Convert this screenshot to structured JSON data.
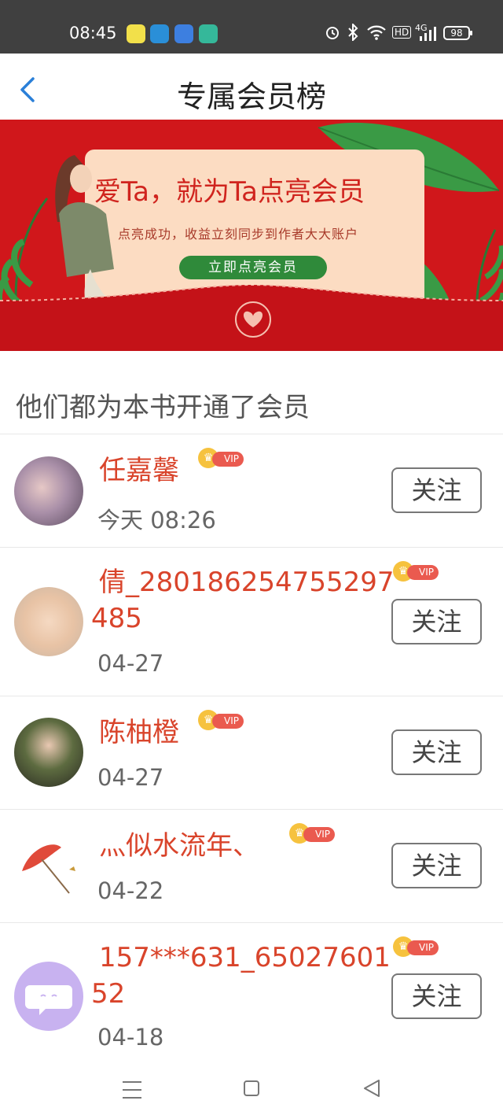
{
  "status_bar": {
    "time": "08:45",
    "hd": "HD",
    "network": "4G",
    "battery": "98"
  },
  "header": {
    "title": "专属会员榜"
  },
  "banner": {
    "headline": "爱Ta，就为Ta点亮会员",
    "subtitle": "点亮成功，收益立刻同步到作者大大账户",
    "button_label": "立即点亮会员"
  },
  "section": {
    "title": "他们都为本书开通了会员"
  },
  "members": [
    {
      "name": "任嘉馨",
      "date": "今天 08:26",
      "badge": "VIP",
      "follow_label": "关注"
    },
    {
      "name": "倩_280186254755297",
      "name_cont": "485",
      "date": "04-27",
      "badge": "VIP",
      "follow_label": "关注"
    },
    {
      "name": "陈柚橙",
      "date": "04-27",
      "badge": "VIP",
      "follow_label": "关注"
    },
    {
      "name": "灬似水流年、",
      "date": "04-22",
      "badge": "VIP",
      "follow_label": "关注"
    },
    {
      "name": "157***631_65027601",
      "name_cont": "52",
      "date": "04-18",
      "badge": "VIP",
      "follow_label": "关注"
    }
  ],
  "colors": {
    "accent_red": "#d0171b",
    "name_color": "#d9442b",
    "vip": "#ea5a4f",
    "crown": "#f6c23e",
    "banner_button": "#2f8a3a"
  }
}
